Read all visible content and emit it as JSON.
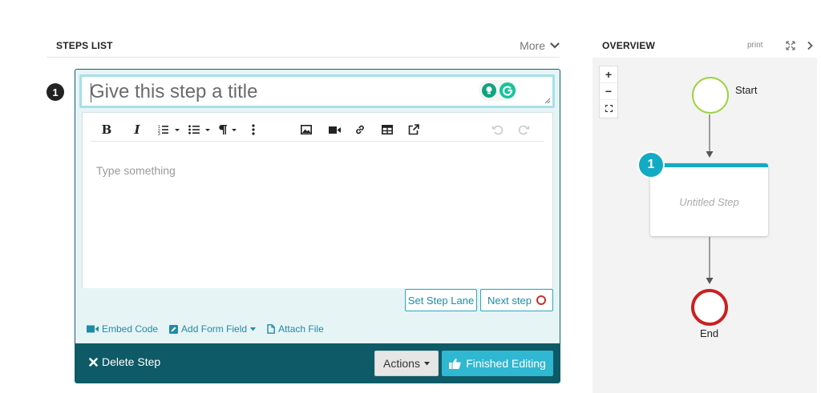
{
  "steps_list": {
    "title": "STEPS LIST",
    "more_label": "More"
  },
  "step": {
    "number": "1",
    "title_placeholder": "Give this step a title",
    "editor_placeholder": "Type something",
    "set_lane_label": "Set Step Lane",
    "next_step_label": "Next step",
    "embed_code_label": "Embed Code",
    "add_form_field_label": "Add Form Field",
    "attach_file_label": "Attach File",
    "delete_label": "Delete Step",
    "actions_label": "Actions",
    "finished_label": "Finished Editing"
  },
  "toolbar": {
    "bold": "B",
    "italic": "I"
  },
  "overview": {
    "title": "OVERVIEW",
    "print_label": "print",
    "zoom_in": "+",
    "zoom_out": "−",
    "start_label": "Start",
    "end_label": "End",
    "step_node_label": "Untitled Step",
    "step_node_number": "1"
  },
  "colors": {
    "accent": "#30b7d1",
    "footer": "#0e5a66",
    "start": "#9bd33e",
    "end": "#cc1f1f"
  }
}
